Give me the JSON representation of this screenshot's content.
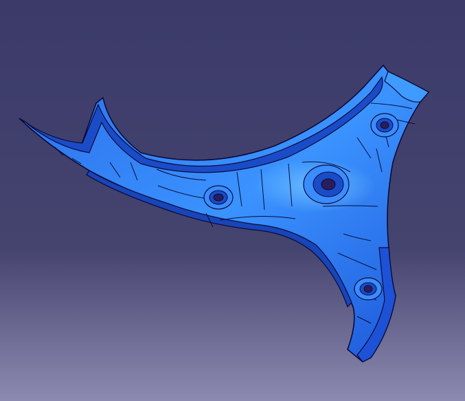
{
  "viewport": {
    "background_top": "#3b3a69",
    "background_mid": "#45446f",
    "background_bottom": "#8c8ab0"
  },
  "part": {
    "name": "three-arm-bracket",
    "face_color": "#2a7af2",
    "face_highlight": "#5fb2ff",
    "face_shadow": "#1c4fd0",
    "edge_color": "#0a0a3a",
    "holes": 4
  }
}
